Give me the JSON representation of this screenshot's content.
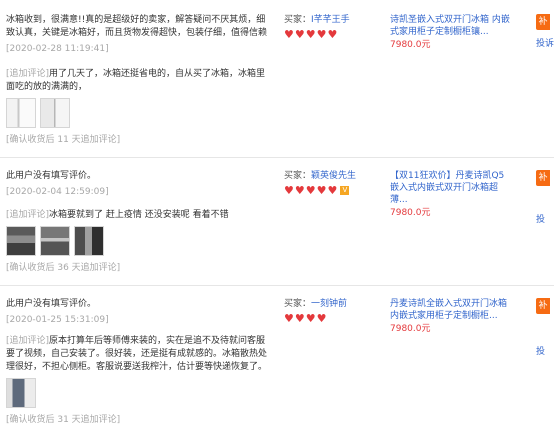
{
  "reviews": [
    {
      "text": "冰箱收到，很满意!!真的是超级好的卖家，解答疑问不厌其烦，细致认真，关键是冰箱好，而且货物发得超快，包装仔细，值得信赖",
      "date": "[2020-02-28 11:19:41]",
      "followup_tag": "[追加评论]",
      "followup_text": "用了几天了，冰箱还挺省电的，自从买了冰箱，冰箱里面吃的放的满满的，",
      "thumbs": [
        "photo-door",
        "photo-door"
      ],
      "followup_note": "[确认收货后 11 天追加评论]",
      "buyer_label": "买家：",
      "buyer_name": "I芊芊王手",
      "hearts": 5,
      "vip": false,
      "product": "诗凯圣嵌入式双开门冰箱 内嵌式家用柜子定制橱柜镶...",
      "price": "7980.0元",
      "side_btn": "补",
      "side_link": "投诉"
    },
    {
      "text": "此用户没有填写评价。",
      "date": "[2020-02-04 12:59:09]",
      "followup_tag": "[追加评论]",
      "followup_text": "冰箱要就到了 赶上疫情 还没安装呢 看着不错",
      "thumbs": [
        "photo-dark",
        "photo-dark",
        "photo-dark"
      ],
      "followup_note": "[确认收货后 36 天追加评论]",
      "buyer_label": "买家：",
      "buyer_name": "颖英俊先生",
      "hearts": 5,
      "vip": true,
      "product": "【双11狂欢价】丹麦诗凯Q5嵌入式内嵌式双开门冰箱超薄...",
      "price": "7980.0元",
      "side_btn": "补",
      "side_link": "投"
    },
    {
      "text": "此用户没有填写评价。",
      "date": "[2020-01-25 15:31:09]",
      "followup_tag": "[追加评论]",
      "followup_text": "原本打算年后等师傅来装的，实在是追不及待就问客服要了视频，自己安装了。很好装，还是挺有成就感的。冰箱散热处理很好，不担心侧柜。客服说要送我榨汁，估计要等快递恢复了。",
      "thumbs": [
        "photo-fridge"
      ],
      "followup_note": "[确认收货后 31 天追加评论]",
      "buyer_label": "买家：",
      "buyer_name": "一刻钟前",
      "hearts": 4,
      "vip": false,
      "product": "丹麦诗凯全嵌入式双开门冰箱内嵌式家用柜子定制橱柜...",
      "price": "7980.0元",
      "side_btn": "补",
      "side_link": "投"
    }
  ]
}
